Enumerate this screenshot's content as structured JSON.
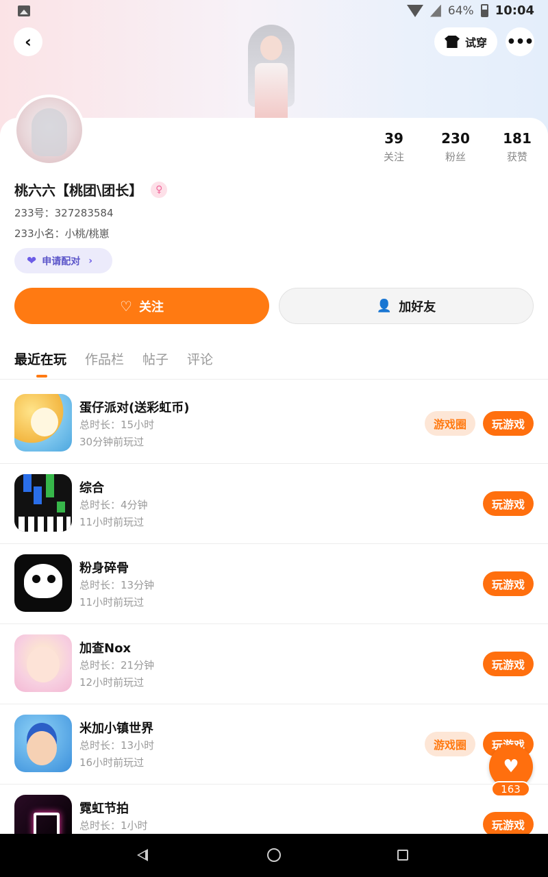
{
  "status_bar": {
    "battery_percent": "64%",
    "time": "10:04"
  },
  "header": {
    "tryon_label": "试穿"
  },
  "profile": {
    "stats": [
      {
        "value": "39",
        "label": "关注"
      },
      {
        "value": "230",
        "label": "粉丝"
      },
      {
        "value": "181",
        "label": "获赞"
      }
    ],
    "nickname": "桃六六【桃团\\团长】",
    "gender_icon": "female-icon",
    "id_line": "233号：327283584",
    "alias_line": "233小名：小桃/桃崽",
    "pair_label": "申请配对"
  },
  "actions": {
    "follow_label": "关注",
    "add_friend_label": "加好友"
  },
  "tabs": [
    "最近在玩",
    "作品栏",
    "帖子",
    "评论"
  ],
  "games": [
    {
      "name": "蛋仔派对(送彩虹币)",
      "duration": "总时长：15小时",
      "last_played": "30分钟前玩过",
      "circle": "游戏圈",
      "play": "玩游戏"
    },
    {
      "name": "综合",
      "duration": "总时长：4分钟",
      "last_played": "11小时前玩过",
      "circle": "",
      "play": "玩游戏"
    },
    {
      "name": "粉身碎骨",
      "duration": "总时长：13分钟",
      "last_played": "11小时前玩过",
      "circle": "",
      "play": "玩游戏"
    },
    {
      "name": "加查Nox",
      "duration": "总时长：21分钟",
      "last_played": "12小时前玩过",
      "circle": "",
      "play": "玩游戏"
    },
    {
      "name": "米加小镇世界",
      "duration": "总时长：13小时",
      "last_played": "16小时前玩过",
      "circle": "游戏圈",
      "play": "玩游戏"
    },
    {
      "name": "霓虹节拍",
      "duration": "总时长：1小时",
      "last_played": "",
      "circle": "",
      "play": "玩游戏"
    }
  ],
  "fab": {
    "like_count": "163"
  },
  "colors": {
    "accent": "#ff7a12",
    "pair_purple": "#5b55c9"
  }
}
